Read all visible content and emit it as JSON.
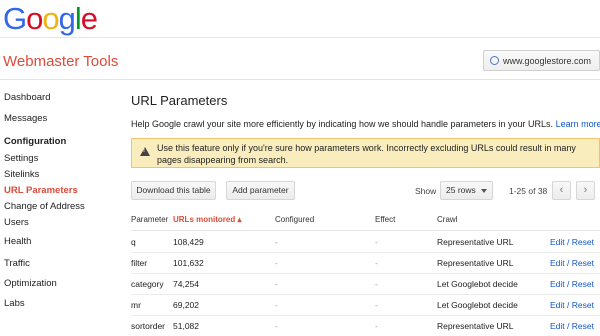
{
  "logo": {
    "letters": [
      "G",
      "o",
      "o",
      "g",
      "l",
      "e"
    ]
  },
  "app": {
    "title": "Webmaster Tools"
  },
  "site_selector": {
    "value": "www.googlestore.com",
    "icon": "globe-icon"
  },
  "sidebar": {
    "items": [
      {
        "label": "Dashboard",
        "type": "item"
      },
      {
        "label": "Messages",
        "type": "item"
      },
      {
        "label": "Configuration",
        "type": "section"
      },
      {
        "label": "Settings",
        "type": "item"
      },
      {
        "label": "Sitelinks",
        "type": "item"
      },
      {
        "label": "URL Parameters",
        "type": "active"
      },
      {
        "label": "Change of Address",
        "type": "item"
      },
      {
        "label": "Users",
        "type": "item"
      },
      {
        "label": "Health",
        "type": "item"
      },
      {
        "label": "Traffic",
        "type": "item"
      },
      {
        "label": "Optimization",
        "type": "item"
      },
      {
        "label": "Labs",
        "type": "item"
      }
    ]
  },
  "main": {
    "title": "URL Parameters",
    "intro": "Help Google crawl your site more efficiently by indicating how we should handle parameters in your URLs.",
    "learn_more": "Learn more.",
    "warning": "Use this feature only if you're sure how parameters work. Incorrectly excluding URLs could result in many pages disappearing from search.",
    "toolbar": {
      "download_label": "Download this table",
      "add_label": "Add parameter",
      "show_label": "Show",
      "rows_value": "25 rows",
      "range": "1-25 of 38",
      "prev": "‹",
      "next": "›"
    },
    "table": {
      "headers": {
        "parameter": "Parameter",
        "urls": "URLs monitored ▴",
        "configured": "Configured",
        "effect": "Effect",
        "crawl": "Crawl"
      },
      "rows": [
        {
          "param": "q",
          "urls": "108,429",
          "configured": "-",
          "effect": "-",
          "crawl": "Representative URL",
          "action": "Edit / Reset"
        },
        {
          "param": "filter",
          "urls": "101,632",
          "configured": "-",
          "effect": "-",
          "crawl": "Representative URL",
          "action": "Edit / Reset"
        },
        {
          "param": "category",
          "urls": "74,254",
          "configured": "-",
          "effect": "-",
          "crawl": "Let Googlebot decide",
          "action": "Edit / Reset"
        },
        {
          "param": "mr",
          "urls": "69,202",
          "configured": "-",
          "effect": "-",
          "crawl": "Let Googlebot decide",
          "action": "Edit / Reset"
        },
        {
          "param": "sortorder",
          "urls": "51,082",
          "configured": "-",
          "effect": "-",
          "crawl": "Representative URL",
          "action": "Edit / Reset"
        }
      ]
    }
  },
  "colors": {
    "brand_red": "#dd4b39",
    "link_blue": "#1155cc",
    "warning_bg": "#f9edbe"
  }
}
